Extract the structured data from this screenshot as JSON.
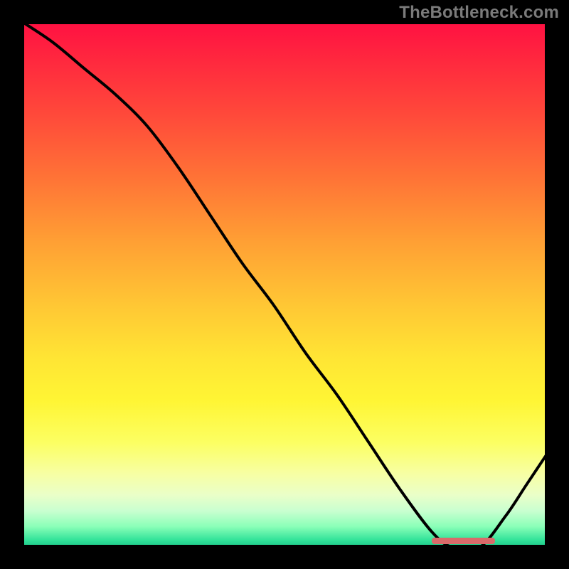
{
  "watermark": "TheBottleneck.com",
  "chart_data": {
    "type": "line",
    "title": "",
    "xlabel": "",
    "ylabel": "",
    "xlim": [
      0,
      100
    ],
    "ylim": [
      0,
      100
    ],
    "series": [
      {
        "name": "bottleneck-curve",
        "x": [
          0,
          6,
          12,
          18,
          24,
          30,
          36,
          42,
          48,
          54,
          60,
          66,
          72,
          78,
          82,
          87,
          92,
          96,
          100
        ],
        "values": [
          100,
          96,
          91,
          86,
          80,
          72,
          63,
          54,
          46,
          37,
          29,
          20,
          11,
          3,
          0,
          0,
          6,
          12,
          18
        ]
      }
    ],
    "annotations": {
      "optimal_range_x": [
        78,
        90
      ]
    },
    "background": "rainbow-vertical-gradient",
    "grid": false,
    "legend": false
  },
  "colors": {
    "curve": "#000000",
    "frame": "#000000",
    "valley_bar": "#d96a6a",
    "watermark": "#7a7a7a"
  }
}
